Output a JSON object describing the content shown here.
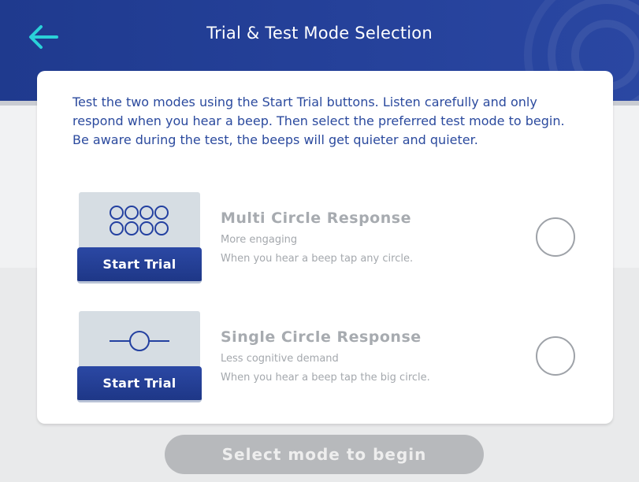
{
  "header": {
    "title": "Trial & Test Mode Selection",
    "back_icon": "arrow-left-icon",
    "colors": {
      "background": "#23409a",
      "back_arrow": "#2ad1d8"
    }
  },
  "instructions": "Test the two modes using the Start Trial buttons. Listen carefully and only respond when you hear a beep. Then select the preferred test mode to begin. Be aware during the test, the beeps will get quieter and quieter.",
  "modes": [
    {
      "icon": "multi-circle-icon",
      "start_trial_label": "Start Trial",
      "title": "Multi Circle Response",
      "subtitle": "More engaging",
      "description": "When you hear a beep tap any circle.",
      "selected": false
    },
    {
      "icon": "single-circle-icon",
      "start_trial_label": "Start Trial",
      "title": "Single Circle Response",
      "subtitle": "Less cognitive demand",
      "description": "When you hear a beep tap the big circle.",
      "selected": false
    }
  ],
  "footer": {
    "select_button_label": "Select mode to begin",
    "enabled": false
  },
  "colors": {
    "accent": "#2b4a9e",
    "button": "#23409a",
    "disabled": "#b7b9bc"
  }
}
